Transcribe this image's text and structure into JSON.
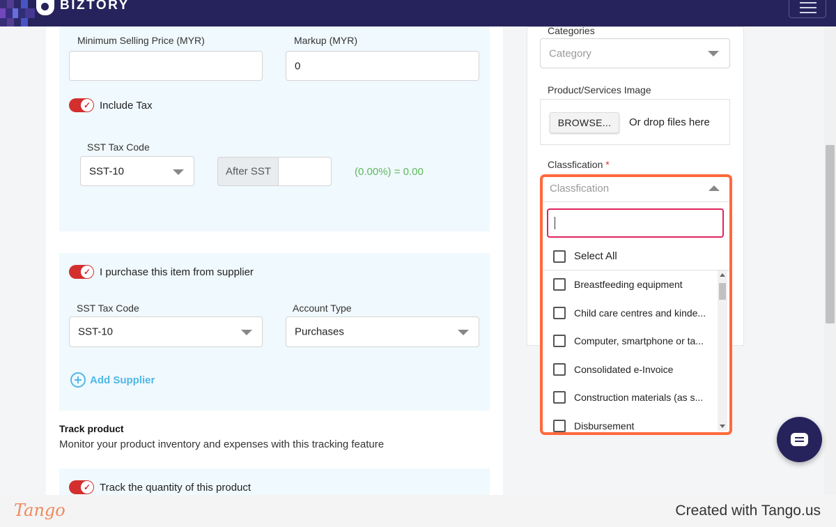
{
  "topbar": {
    "brand": "BIZTORY",
    "accent": "#26235c"
  },
  "pricing": {
    "min_price_label": "Minimum Selling Price (MYR)",
    "min_price_value": "",
    "markup_label": "Markup (MYR)",
    "markup_value": "0",
    "include_tax_label": "Include Tax",
    "include_tax_on": true,
    "sst_label": "SST Tax Code",
    "sst_value": "SST-10",
    "after_sst_label": "After SST",
    "after_sst_value": "",
    "tax_result": "(0.00%) = 0.00"
  },
  "purchase": {
    "toggle_label": "I purchase this item from supplier",
    "toggle_on": true,
    "sst_label": "SST Tax Code",
    "sst_value": "SST-10",
    "account_type_label": "Account Type",
    "account_type_value": "Purchases",
    "add_supplier_label": "Add Supplier"
  },
  "track": {
    "title": "Track product",
    "description": "Monitor your product inventory and expenses with this tracking feature",
    "quantity_toggle_label": "Track the quantity of this product",
    "quantity_toggle_on": true
  },
  "sidebar": {
    "categories_label": "Categories",
    "category_placeholder": "Category",
    "image_label": "Product/Services Image",
    "browse_label": "BROWSE...",
    "drop_text": "Or drop files here",
    "classification_label": "Classfication",
    "classification_required": "*",
    "classification_placeholder": "Classfication"
  },
  "dropdown": {
    "search_value": "",
    "select_all_label": "Select All",
    "options": [
      "Breastfeeding equipment",
      "Child care centres and kinde...",
      "Computer, smartphone or ta...",
      "Consolidated e-Invoice",
      "Construction materials (as s...",
      "Disbursement"
    ]
  },
  "footer": {
    "logo": "Tango",
    "created_text": "Created with Tango.us"
  },
  "colors": {
    "toggle": "#d32f2f",
    "highlight": "#ff6a3d",
    "link": "#4fb7e8",
    "success": "#5cb85c"
  }
}
